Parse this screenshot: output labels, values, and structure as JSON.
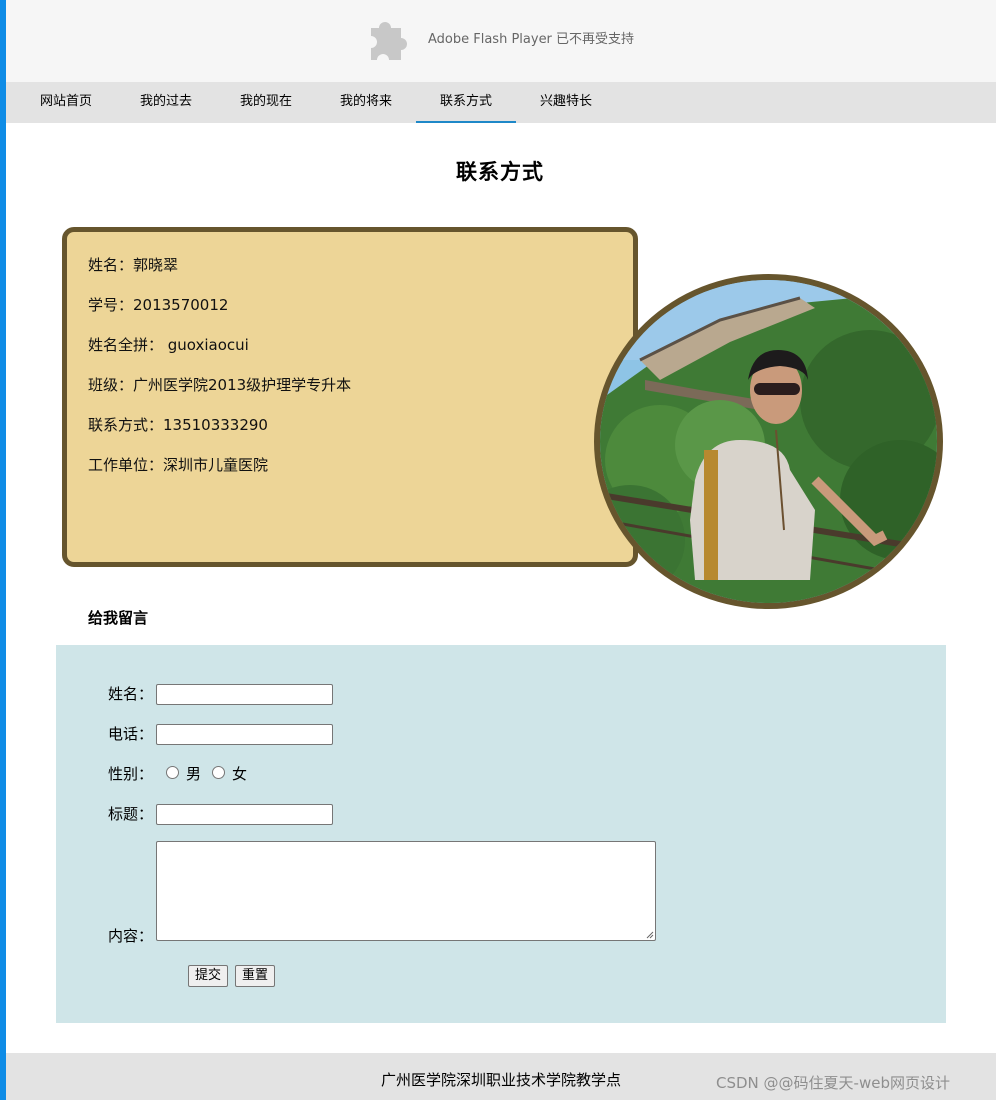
{
  "flash_notice": "Adobe Flash Player 已不再受支持",
  "nav": {
    "items": [
      "网站首页",
      "我的过去",
      "我的现在",
      "我的将来",
      "联系方式",
      "兴趣特长"
    ],
    "active_index": 4
  },
  "page_title": "联系方式",
  "profile": {
    "name": "姓名：郭晓翠",
    "student_id": "学号：2013570012",
    "pinyin": "姓名全拼： guoxiaocui",
    "class": "班级：广州医学院2013级护理学专升本",
    "contact": "联系方式：13510333290",
    "workplace": "工作单位：深圳市儿童医院"
  },
  "message": {
    "heading": "给我留言",
    "name_label": "姓名：",
    "phone_label": "电话：",
    "gender_label": "性别：",
    "gender_options": [
      "男",
      "女"
    ],
    "subject_label": "标题：",
    "content_label": "内容：",
    "name_value": "",
    "phone_value": "",
    "subject_value": "",
    "content_value": "",
    "submit_label": "提交",
    "reset_label": "重置"
  },
  "footer": "广州医学院深圳职业技术学院教学点",
  "watermark": "CSDN @@码住夏天-web网页设计",
  "colors": {
    "accent_blue": "#0f8ce6",
    "info_box_bg": "#edd597",
    "info_box_border": "#66552d",
    "form_bg": "#cfe5e8",
    "nav_bg": "#e3e3e3"
  },
  "icons": {
    "flash": "puzzle-piece-icon"
  }
}
